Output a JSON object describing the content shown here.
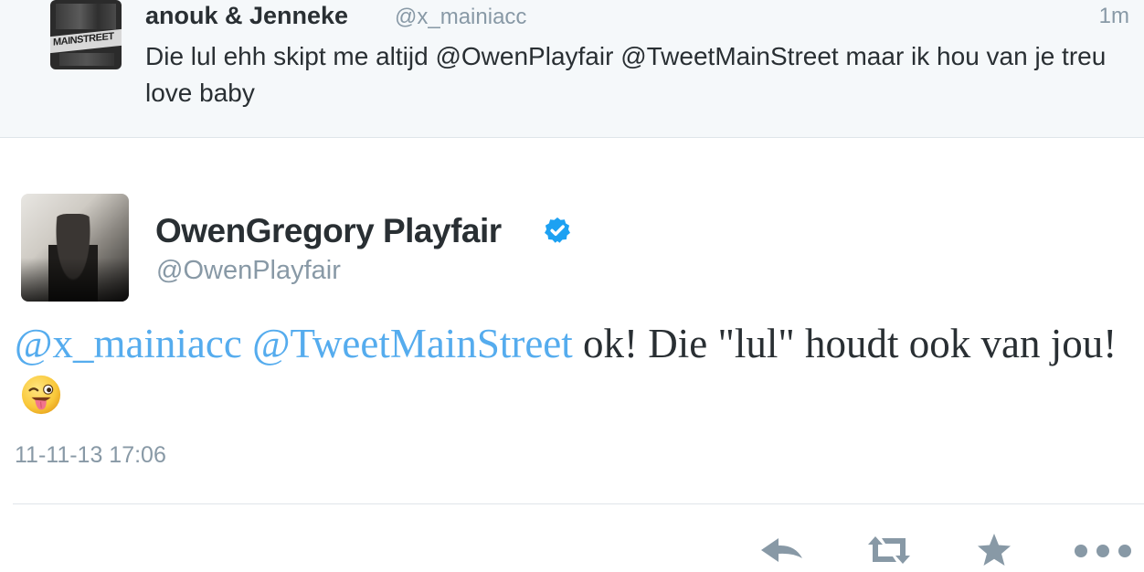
{
  "reply_tweet": {
    "author_name": "anouk & Jenneke",
    "author_handle": "@x_mainiacc",
    "time_ago": "1m",
    "text": "Die lul ehh skipt me altijd @OwenPlayfair @TweetMainStreet maar ik hou van je treu love baby",
    "avatar_text": "MAINSTREET"
  },
  "main_tweet": {
    "author_name": "OwenGregory Playfair",
    "author_handle": "@OwenPlayfair",
    "verified": true,
    "mention_1": "@x_mainiacc",
    "mention_2": "@TweetMainStreet",
    "text_body": "ok! Die \"lul\" houdt ook van jou!",
    "emoji": "winking-face-with-tongue",
    "timestamp": "11-11-13 17:06"
  },
  "actions": {
    "reply_icon": "reply-icon",
    "retweet_icon": "retweet-icon",
    "favorite_icon": "star-icon",
    "more_icon": "more-icon"
  },
  "colors": {
    "link": "#55acee",
    "secondary_text": "#8899a6",
    "primary_text": "#292f33",
    "verified": "#1da1f2",
    "action_icon": "#8899a6"
  }
}
